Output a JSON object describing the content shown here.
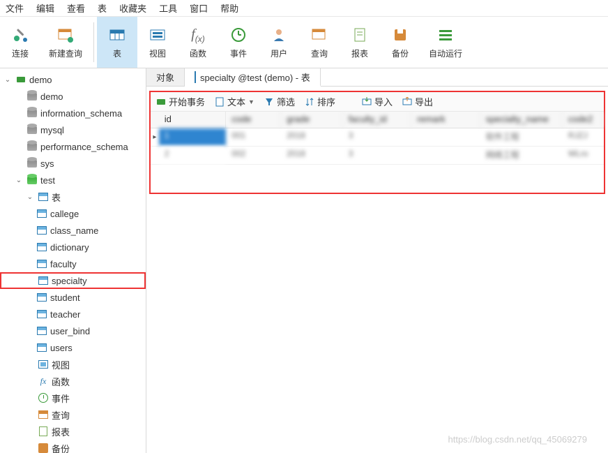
{
  "menubar": [
    "文件",
    "编辑",
    "查看",
    "表",
    "收藏夹",
    "工具",
    "窗口",
    "帮助"
  ],
  "toolbar": [
    {
      "label": "连接",
      "icon": "connect"
    },
    {
      "label": "新建查询",
      "icon": "newquery"
    },
    {
      "label": "表",
      "icon": "table",
      "active": true
    },
    {
      "label": "视图",
      "icon": "view"
    },
    {
      "label": "函数",
      "icon": "fx"
    },
    {
      "label": "事件",
      "icon": "event"
    },
    {
      "label": "用户",
      "icon": "user"
    },
    {
      "label": "查询",
      "icon": "query"
    },
    {
      "label": "报表",
      "icon": "report"
    },
    {
      "label": "备份",
      "icon": "backup"
    },
    {
      "label": "自动运行",
      "icon": "auto"
    }
  ],
  "tree": {
    "root": "demo",
    "schemas": [
      "demo",
      "information_schema",
      "mysql",
      "performance_schema",
      "sys"
    ],
    "active_db": "test",
    "tables_label": "表",
    "tables": [
      "callege",
      "class_name",
      "dictionary",
      "faculty",
      "specialty",
      "student",
      "teacher",
      "user_bind",
      "users"
    ],
    "selected_table": "specialty",
    "extras": [
      {
        "label": "视图",
        "icon": "view"
      },
      {
        "label": "函数",
        "icon": "fx"
      },
      {
        "label": "事件",
        "icon": "clock"
      },
      {
        "label": "查询",
        "icon": "table"
      },
      {
        "label": "报表",
        "icon": "doc"
      },
      {
        "label": "备份",
        "icon": "save"
      }
    ]
  },
  "tabs": {
    "object": "对象",
    "active": "specialty @test (demo) - 表"
  },
  "actionbar": {
    "begin_txn": "开始事务",
    "text": "文本",
    "filter": "筛选",
    "sort": "排序",
    "import": "导入",
    "export": "导出"
  },
  "grid": {
    "columns": [
      "id",
      "code",
      "grade",
      "faculty_id",
      "remark",
      "specialty_name",
      "code2"
    ],
    "rows": [
      [
        "1",
        "001",
        "2018",
        "3",
        "",
        "软件工程",
        "RJZJ"
      ],
      [
        "2",
        "002",
        "2018",
        "3",
        "",
        "网络工程",
        "WLro"
      ]
    ]
  },
  "watermark": "https://blog.csdn.net/qq_45069279"
}
